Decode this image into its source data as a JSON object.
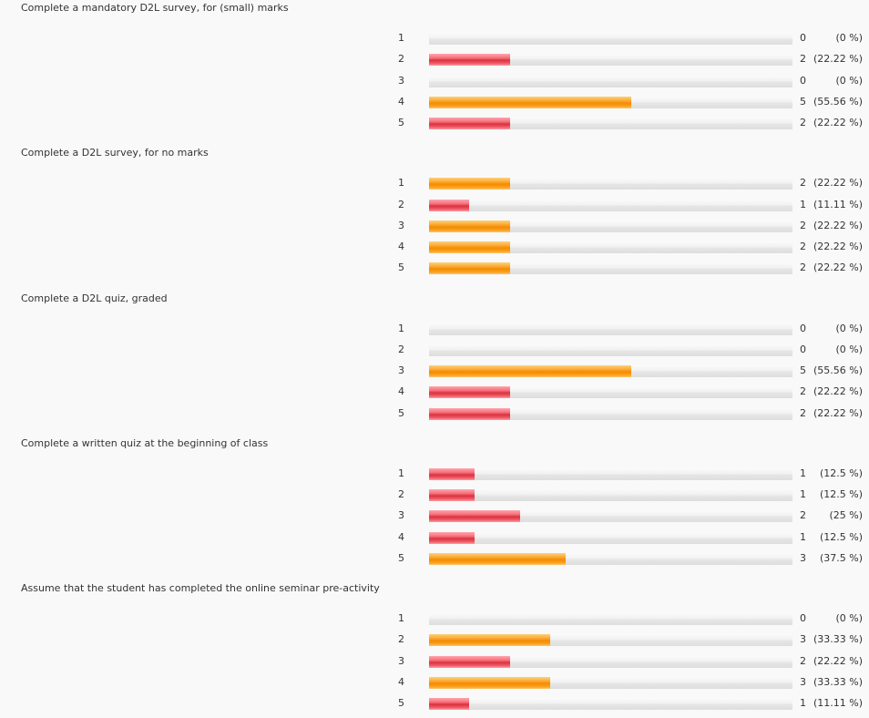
{
  "chart_data": [
    {
      "type": "bar",
      "orientation": "horizontal",
      "title": "Complete a mandatory D2L survey, for (small) marks",
      "categories": [
        "1",
        "2",
        "3",
        "4",
        "5"
      ],
      "values": [
        0,
        2,
        0,
        5,
        2
      ],
      "percent_labels": [
        "(0 %)",
        "(22.22 %)",
        "(0 %)",
        "(55.56 %)",
        "(22.22 %)"
      ],
      "xlim": [
        0,
        9
      ]
    },
    {
      "type": "bar",
      "orientation": "horizontal",
      "title": "Complete a D2L survey, for no marks",
      "categories": [
        "1",
        "2",
        "3",
        "4",
        "5"
      ],
      "values": [
        2,
        1,
        2,
        2,
        2
      ],
      "percent_labels": [
        "(22.22 %)",
        "(11.11 %)",
        "(22.22 %)",
        "(22.22 %)",
        "(22.22 %)"
      ],
      "xlim": [
        0,
        9
      ]
    },
    {
      "type": "bar",
      "orientation": "horizontal",
      "title": "Complete a D2L quiz, graded",
      "categories": [
        "1",
        "2",
        "3",
        "4",
        "5"
      ],
      "values": [
        0,
        0,
        5,
        2,
        2
      ],
      "percent_labels": [
        "(0 %)",
        "(0 %)",
        "(55.56 %)",
        "(22.22 %)",
        "(22.22 %)"
      ],
      "xlim": [
        0,
        9
      ]
    },
    {
      "type": "bar",
      "orientation": "horizontal",
      "title": "Complete a written quiz at the beginning of class",
      "categories": [
        "1",
        "2",
        "3",
        "4",
        "5"
      ],
      "values": [
        1,
        1,
        2,
        1,
        3
      ],
      "percent_labels": [
        "(12.5 %)",
        "(12.5 %)",
        "(25 %)",
        "(12.5 %)",
        "(37.5 %)"
      ],
      "xlim": [
        0,
        8
      ]
    },
    {
      "type": "bar",
      "orientation": "horizontal",
      "title": "Assume that the student has completed the online seminar pre-activity",
      "categories": [
        "1",
        "2",
        "3",
        "4",
        "5"
      ],
      "values": [
        0,
        3,
        2,
        3,
        1
      ],
      "percent_labels": [
        "(0 %)",
        "(33.33 %)",
        "(22.22 %)",
        "(33.33 %)",
        "(11.11 %)"
      ],
      "xlim": [
        0,
        9
      ]
    }
  ],
  "colors": {
    "highest_bar": "#f58b00",
    "bar": "#d9333f",
    "track": "#e6e6e6",
    "text": "#333333",
    "background": "#f9f9f9"
  }
}
